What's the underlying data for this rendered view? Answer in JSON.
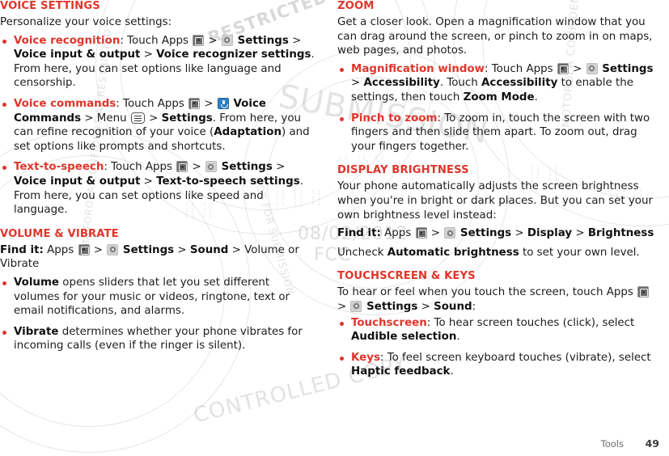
{
  "document": {
    "footer": {
      "chapter_label": "Tools",
      "page_number": "49"
    },
    "watermark": {
      "line1": "RESTRICTED :: MOTOROLA CONFIDENTIAL",
      "line2": "SUBMISSION",
      "line3": "08/02/2012",
      "line4": "FCC",
      "line5": "MOTOROLA CONFIDENTIAL RESTRICTED",
      "line6": "NOT FOR SUBMISSION",
      "line7": "MOTOROLA CONFIDENTIAL RESTRICTED BY",
      "line8": "CONTROLLED COPY"
    },
    "colors": {
      "heading_red": "#E0352B",
      "term_red": "#E0352B",
      "body_text": "#1c1c1c",
      "voice_icon_blue": "#2f7fc4"
    }
  },
  "left_column": {
    "sections": [
      {
        "id": "voice-settings",
        "heading": "VOICE SETTINGS",
        "intro": "Personalize your voice settings:",
        "bullets": [
          {
            "id": "voice-recognition",
            "term": "Voice recognition",
            "parts": [
              {
                "type": "text",
                "value": ": Touch Apps "
              },
              {
                "type": "icon",
                "value": "apps-icon"
              },
              {
                "type": "text",
                "value": " > "
              },
              {
                "type": "icon",
                "value": "settings-gear-icon"
              },
              {
                "type": "bold",
                "value": " Settings"
              },
              {
                "type": "text",
                "value": " > "
              },
              {
                "type": "bold",
                "value": "Voice input & output"
              },
              {
                "type": "text",
                "value": " > "
              },
              {
                "type": "bold",
                "value": "Voice recognizer settings"
              },
              {
                "type": "text",
                "value": ". From here, you can set options like language and censorship."
              }
            ]
          },
          {
            "id": "voice-commands",
            "term": "Voice commands",
            "parts": [
              {
                "type": "text",
                "value": ": Touch Apps "
              },
              {
                "type": "icon",
                "value": "apps-icon"
              },
              {
                "type": "text",
                "value": " > "
              },
              {
                "type": "icon",
                "value": "voice-commands-icon"
              },
              {
                "type": "bold",
                "value": " Voice Commands"
              },
              {
                "type": "text",
                "value": " > Menu "
              },
              {
                "type": "icon",
                "value": "menu-icon"
              },
              {
                "type": "text",
                "value": " > "
              },
              {
                "type": "bold",
                "value": "Settings"
              },
              {
                "type": "text",
                "value": ". From here, you can refine recognition of your voice ("
              },
              {
                "type": "bold",
                "value": "Adaptation"
              },
              {
                "type": "text",
                "value": ") and set options like prompts and shortcuts."
              }
            ]
          },
          {
            "id": "text-to-speech",
            "term": "Text-to-speech",
            "parts": [
              {
                "type": "text",
                "value": ": Touch Apps "
              },
              {
                "type": "icon",
                "value": "apps-icon"
              },
              {
                "type": "text",
                "value": " > "
              },
              {
                "type": "icon",
                "value": "settings-gear-icon"
              },
              {
                "type": "bold",
                "value": " Settings"
              },
              {
                "type": "text",
                "value": " > "
              },
              {
                "type": "bold",
                "value": "Voice input & output"
              },
              {
                "type": "text",
                "value": " > "
              },
              {
                "type": "bold",
                "value": "Text-to-speech settings"
              },
              {
                "type": "text",
                "value": ". From here, you can set options like speed and language."
              }
            ]
          }
        ]
      },
      {
        "id": "volume-and-vibrate",
        "heading": "VOLUME & VIBRATE",
        "find_it": {
          "label": "Find it:",
          "path_prefix": " Apps ",
          "path_mid": " > ",
          "settings_label": " Settings",
          "path_suffix": " > ",
          "sound_label": "Sound",
          "path_tail": " > Volume or Vibrate"
        },
        "bullets": [
          {
            "id": "volume",
            "term_bold": "Volume",
            "text": " opens sliders that let you set different volumes for your music or videos, ringtone, text or email notifications, and alarms."
          },
          {
            "id": "vibrate",
            "term_bold": "Vibrate",
            "text": " determines whether your phone vibrates for incoming calls (even if the ringer is silent)."
          }
        ]
      }
    ]
  },
  "right_column": {
    "sections": [
      {
        "id": "zoom",
        "heading": "ZOOM",
        "intro": "Get a closer look. Open a magnification window that you can drag around the screen, or pinch to zoom in on maps, web pages, and photos.",
        "bullets": [
          {
            "id": "magnification-window",
            "term": "Magnification window",
            "parts": [
              {
                "type": "text",
                "value": ": Touch Apps "
              },
              {
                "type": "icon",
                "value": "apps-icon"
              },
              {
                "type": "text",
                "value": " > "
              },
              {
                "type": "icon",
                "value": "settings-gear-icon"
              },
              {
                "type": "bold",
                "value": " Settings"
              },
              {
                "type": "text",
                "value": " > "
              },
              {
                "type": "bold",
                "value": "Accessibility"
              },
              {
                "type": "text",
                "value": ". Touch "
              },
              {
                "type": "bold",
                "value": "Accessibility"
              },
              {
                "type": "text",
                "value": " to enable the settings, then touch "
              },
              {
                "type": "bold",
                "value": "Zoom Mode"
              },
              {
                "type": "text",
                "value": "."
              }
            ]
          },
          {
            "id": "pinch-to-zoom",
            "term": "Pinch to zoom",
            "parts": [
              {
                "type": "text",
                "value": ": To zoom in, touch the screen with two fingers and then slide them apart. To zoom out, drag your fingers together."
              }
            ]
          }
        ]
      },
      {
        "id": "display-brightness",
        "heading": "DISPLAY BRIGHTNESS",
        "intro": "Your phone automatically adjusts the screen brightness when you're in bright or dark places. But you can set your own brightness level instead:",
        "find_it": {
          "label": "Find it:",
          "path_prefix": " Apps ",
          "path_mid": " > ",
          "settings_label": " Settings",
          "path_suffix": " > ",
          "display_label": "Display",
          "path_tail2": " > ",
          "brightness_label": "Brightness"
        },
        "note_prefix": "Uncheck ",
        "note_bold": "Automatic brightness",
        "note_suffix": " to set your own level."
      },
      {
        "id": "touchscreen-and-keys",
        "heading": "TOUCHSCREEN & KEYS",
        "intro_prefix": "To hear or feel when you touch the screen, touch Apps ",
        "intro_mid": " > ",
        "intro_settings": " Settings",
        "intro_gt": " > ",
        "intro_sound": "Sound",
        "intro_colon": ":",
        "bullets": [
          {
            "id": "touchscreen",
            "term": "Touchscreen",
            "parts": [
              {
                "type": "text",
                "value": ": To hear screen touches (click), select "
              },
              {
                "type": "bold",
                "value": "Audible selection"
              },
              {
                "type": "text",
                "value": "."
              }
            ]
          },
          {
            "id": "keys",
            "term": "Keys",
            "parts": [
              {
                "type": "text",
                "value": ": To feel screen keyboard touches (vibrate), select "
              },
              {
                "type": "bold",
                "value": "Haptic feedback"
              },
              {
                "type": "text",
                "value": "."
              }
            ]
          }
        ]
      }
    ]
  }
}
